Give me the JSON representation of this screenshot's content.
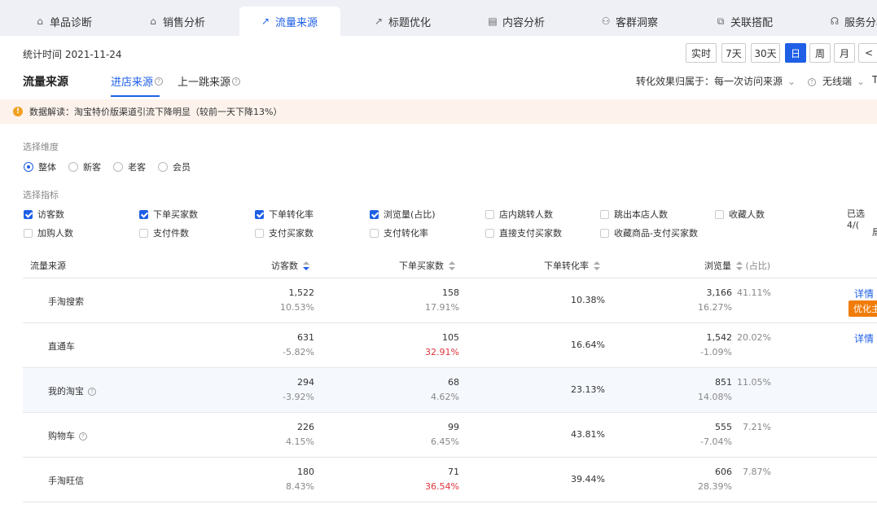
{
  "nav": {
    "tabs": [
      {
        "label": "单品诊断",
        "icon": "box-icon"
      },
      {
        "label": "销售分析",
        "icon": "box-icon"
      },
      {
        "label": "流量来源",
        "icon": "line-chart-icon"
      },
      {
        "label": "标题优化",
        "icon": "line-chart-icon"
      },
      {
        "label": "内容分析",
        "icon": "doc-icon"
      },
      {
        "label": "客群洞察",
        "icon": "users-icon"
      },
      {
        "label": "关联搭配",
        "icon": "link-icon"
      },
      {
        "label": "服务分析",
        "icon": "headset-icon"
      }
    ]
  },
  "header": {
    "date_label": "统计时间 2021-11-24",
    "periods": [
      "实时",
      "7天",
      "30天",
      "日",
      "周",
      "月"
    ],
    "prev": "<"
  },
  "page": {
    "title": "流量来源",
    "subtabs": [
      "进店来源",
      "上一跳来源"
    ],
    "attr_label": "转化效果归属于：",
    "attr_value": "每一次访问来源",
    "device": "无线端",
    "extra": "T"
  },
  "alert": {
    "text": "数据解读：淘宝特价版渠道引流下降明显（较前一天下降13%）"
  },
  "filters": {
    "dimension_label": "选择维度",
    "dimensions": [
      "整体",
      "新客",
      "老客",
      "会员"
    ],
    "metric_label": "选择指标",
    "metrics": [
      {
        "label": "访客数",
        "checked": true
      },
      {
        "label": "下单买家数",
        "checked": true
      },
      {
        "label": "下单转化率",
        "checked": true
      },
      {
        "label": "浏览量(占比)",
        "checked": true
      },
      {
        "label": "店内跳转人数",
        "checked": false
      },
      {
        "label": "跳出本店人数",
        "checked": false
      },
      {
        "label": "收藏人数",
        "checked": false
      },
      {
        "label": "加购人数",
        "checked": false
      },
      {
        "label": "支付件数",
        "checked": false
      },
      {
        "label": "支付买家数",
        "checked": false
      },
      {
        "label": "支付转化率",
        "checked": false
      },
      {
        "label": "直接支付买家数",
        "checked": false
      },
      {
        "label": "收藏商品-支付买家数",
        "checked": false
      }
    ],
    "selected_text": "已选 4/(",
    "extra_char": "局"
  },
  "table": {
    "headers": [
      "流量来源",
      "访客数",
      "下单买家数",
      "下单转化率",
      "浏览量",
      "(占比)"
    ],
    "rows": [
      {
        "name": "手淘搜索",
        "help": false,
        "visitors": "1,522",
        "visitors_chg": "10.53%",
        "buyers": "158",
        "buyers_chg": "17.91%",
        "buyers_red": false,
        "rate": "10.38%",
        "pv": "3,166",
        "pv_chg": "16.27%",
        "share": "41.11%",
        "op": "详情",
        "tag": "优化主"
      },
      {
        "name": "直通车",
        "help": false,
        "visitors": "631",
        "visitors_chg": "-5.82%",
        "buyers": "105",
        "buyers_chg": "32.91%",
        "buyers_red": true,
        "rate": "16.64%",
        "pv": "1,542",
        "pv_chg": "-1.09%",
        "share": "20.02%",
        "op": "详情"
      },
      {
        "name": "我的淘宝",
        "help": true,
        "visitors": "294",
        "visitors_chg": "-3.92%",
        "buyers": "68",
        "buyers_chg": "4.62%",
        "buyers_red": false,
        "rate": "23.13%",
        "pv": "851",
        "pv_chg": "14.08%",
        "share": "11.05%"
      },
      {
        "name": "购物车",
        "help": true,
        "visitors": "226",
        "visitors_chg": "4.15%",
        "buyers": "99",
        "buyers_chg": "6.45%",
        "buyers_red": false,
        "rate": "43.81%",
        "pv": "555",
        "pv_chg": "-7.04%",
        "share": "7.21%"
      },
      {
        "name": "手淘旺信",
        "help": false,
        "visitors": "180",
        "visitors_chg": "8.43%",
        "buyers": "71",
        "buyers_chg": "36.54%",
        "buyers_red": true,
        "rate": "39.44%",
        "pv": "606",
        "pv_chg": "28.39%",
        "share": "7.87%"
      }
    ]
  },
  "colors": {
    "accent": "#1e5fe6",
    "negative": "#e0323c",
    "tag": "#f07c0a",
    "alert_bg": "#fdf3ec"
  }
}
